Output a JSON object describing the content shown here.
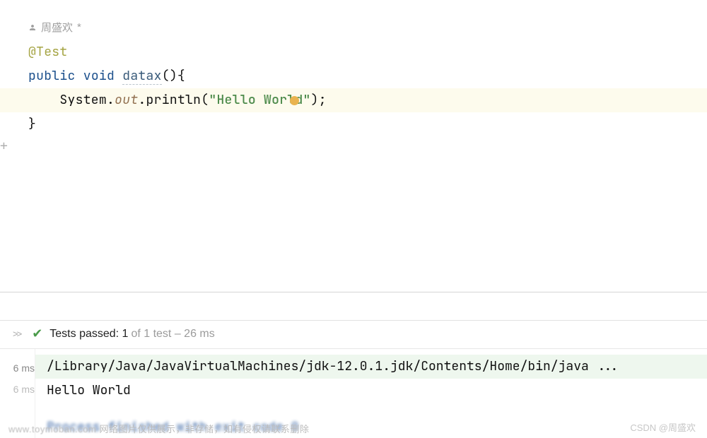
{
  "author": {
    "name": "周盛欢",
    "dirty_marker": "*"
  },
  "code": {
    "annotation": "@Test",
    "kw_public": "public",
    "kw_void": "void",
    "method_name": "datax",
    "open_signature": "(){",
    "indent": "    ",
    "sys": "System",
    "dot": ".",
    "out": "out",
    "println": "println",
    "lparen": "(",
    "string": "\"Hello World\"",
    "tail": ");",
    "close_brace": "}"
  },
  "gutter": {
    "plus": "+"
  },
  "results": {
    "header_strong": "Tests passed: 1",
    "header_rest": " of 1 test – 26 ms",
    "timings": {
      "t1": "6 ms",
      "t2": "6 ms"
    },
    "console_line1": "/Library/Java/JavaVirtualMachines/jdk-12.0.1.jdk/Contents/Home/bin/java ...",
    "console_line2": "Hello World",
    "console_line3": "Process finished with exit code 0"
  },
  "watermarks": {
    "left_1": "www.toymoban.com",
    "left_2": " 网络图片仅供展示，非存储，如有侵权请联系删除",
    "right": "CSDN @周盛欢"
  }
}
